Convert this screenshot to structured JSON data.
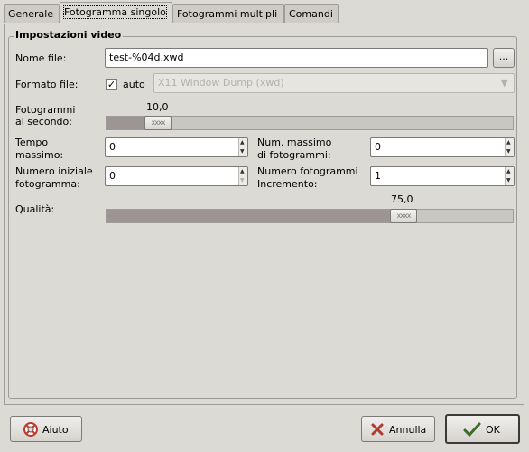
{
  "tabs": [
    {
      "label": "Generale",
      "active": false
    },
    {
      "label": "Fotogramma singolo",
      "active": true
    },
    {
      "label": "Fotogrammi multipli",
      "active": false
    },
    {
      "label": "Comandi",
      "active": false
    }
  ],
  "section_title": "Impostazioni video",
  "filename": {
    "label": "Nome file:",
    "value": "test-%04d.xwd",
    "browse_label": "..."
  },
  "format": {
    "label": "Formato file:",
    "auto_label": "auto",
    "auto_checked": true,
    "value": "X11 Window Dump (xwd)"
  },
  "fps": {
    "label_line1": "Fotogrammi",
    "label_line2": "al secondo:",
    "value_text": "10,0",
    "fraction": 0.1
  },
  "max_time": {
    "label_line1": "Tempo",
    "label_line2": "massimo:",
    "value": "0"
  },
  "max_frames": {
    "label_line1": "Num. massimo",
    "label_line2": "di fotogrammi:",
    "value": "0"
  },
  "start_frame": {
    "label_line1": "Numero iniziale",
    "label_line2": "fotogramma:",
    "value": "0"
  },
  "frame_increment": {
    "label_line1": "Numero fotogrammi",
    "label_line2": "Incremento:",
    "value": "1"
  },
  "quality": {
    "label": "Qualità:",
    "value_text": "75,0",
    "fraction": 0.75
  },
  "buttons": {
    "help": "Aiuto",
    "cancel": "Annulla",
    "ok": "OK"
  },
  "icons": {
    "help": "lifebuoy-icon",
    "cancel": "x-icon",
    "ok": "checkmark-icon",
    "checkbox": "check-icon"
  }
}
